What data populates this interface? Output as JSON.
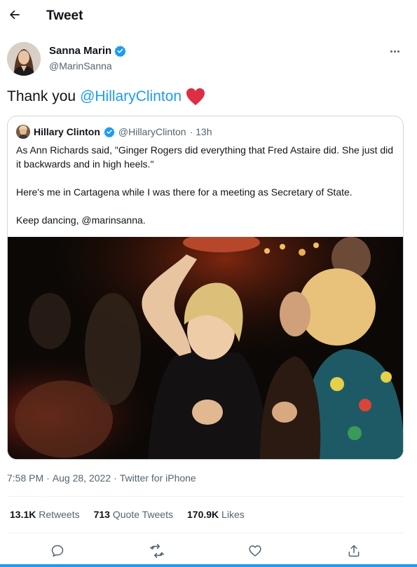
{
  "header": {
    "title": "Tweet",
    "back_icon": "arrow-left-icon"
  },
  "author": {
    "name": "Sanna Marin",
    "handle": "@MarinSanna",
    "verified": true,
    "more_icon": "more-horizontal-icon"
  },
  "tweet": {
    "text_prefix": "Thank you",
    "mention": "@HillaryClinton",
    "emoji": "red-heart-emoji"
  },
  "quote": {
    "name": "Hillary Clinton",
    "handle": "@HillaryClinton",
    "time": "· 13h",
    "verified": true,
    "paragraphs": [
      "As Ann Richards said, \"Ginger Rogers did everything that Fred Astaire did. She just did it backwards and in high heels.\"",
      "Here's me in Cartagena while I was there for a meeting as Secretary of State.",
      "Keep dancing, @marinsanna."
    ]
  },
  "meta": {
    "time": "7:58 PM",
    "separator1": "·",
    "date": "Aug 28, 2022",
    "separator2": "·",
    "source": "Twitter for iPhone"
  },
  "stats": {
    "retweets_count": "13.1K",
    "retweets_label": "Retweets",
    "quotes_count": "713",
    "quotes_label": "Quote Tweets",
    "likes_count": "170.9K",
    "likes_label": "Likes"
  },
  "actions": [
    "reply-icon",
    "retweet-icon",
    "like-icon",
    "share-icon"
  ],
  "colors": {
    "accent": "#1d9bf0",
    "text": "#0f1419",
    "secondary": "#536471",
    "heart": "#f91880",
    "border": "#cfd9de"
  }
}
